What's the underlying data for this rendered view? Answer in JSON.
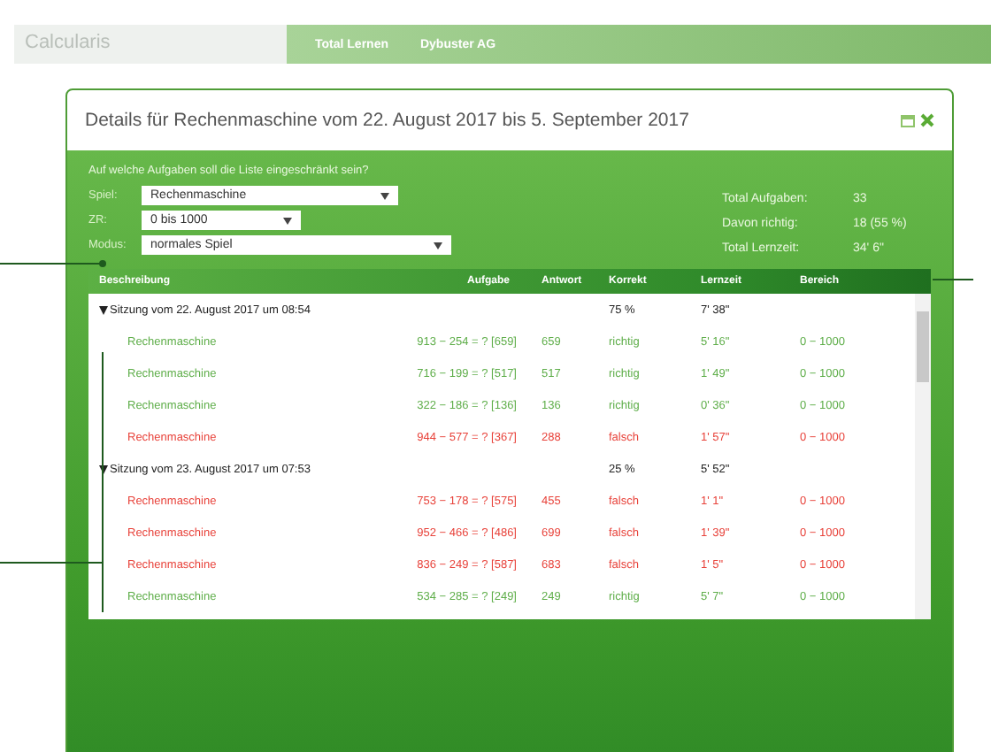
{
  "app": {
    "logo": "Calcularis",
    "nav": [
      "Total Lernen",
      "Dybuster AG"
    ]
  },
  "dialog": {
    "title": "Details für Rechenmaschine vom 22. August 2017 bis 5. September 2017",
    "question": "Auf welche Aufgaben soll die Liste eingeschränkt sein?",
    "filters": [
      {
        "label": "Spiel:",
        "value": "Rechenmaschine"
      },
      {
        "label": "ZR:",
        "value": "0 bis 1000"
      },
      {
        "label": "Modus:",
        "value": "normales Spiel"
      }
    ],
    "totals": [
      {
        "label": "Total Aufgaben:",
        "value": "33"
      },
      {
        "label": "Davon richtig:",
        "value": "18 (55 %)"
      },
      {
        "label": "Total Lernzeit:",
        "value": "34' 6\""
      }
    ],
    "columns": [
      "Beschreibung",
      "Aufgabe",
      "Antwort",
      "Korrekt",
      "Lernzeit",
      "Bereich"
    ],
    "sessions": [
      {
        "title": "Sitzung vom 22. August 2017 um 08:54",
        "expanded": true,
        "percent": "75 %",
        "time": "7' 38\"",
        "children": [
          {
            "name": "Rechenmaschine",
            "task": "913 − 254 = ? [659]",
            "answer": "659",
            "correct": true,
            "result": "richtig",
            "time": "5' 16\"",
            "range": "0 − 1000"
          },
          {
            "name": "Rechenmaschine",
            "task": "716 − 199 = ? [517]",
            "answer": "517",
            "correct": true,
            "result": "richtig",
            "time": "1' 49\"",
            "range": "0 − 1000"
          },
          {
            "name": "Rechenmaschine",
            "task": "322 − 186 = ? [136]",
            "answer": "136",
            "correct": true,
            "result": "richtig",
            "time": "0' 36\"",
            "range": "0 − 1000"
          },
          {
            "name": "Rechenmaschine",
            "task": "944 − 577 = ? [367]",
            "answer": "288",
            "correct": false,
            "result": "falsch",
            "time": "1' 57\"",
            "range": "0 − 1000"
          }
        ]
      },
      {
        "title": "Sitzung vom 23. August 2017 um 07:53",
        "expanded": true,
        "percent": "25 %",
        "time": "5' 52\"",
        "children": [
          {
            "name": "Rechenmaschine",
            "task": "753 − 178 = ? [575]",
            "answer": "455",
            "correct": false,
            "result": "falsch",
            "time": "1' 1\"",
            "range": "0 − 1000"
          },
          {
            "name": "Rechenmaschine",
            "task": "952 − 466 = ? [486]",
            "answer": "699",
            "correct": false,
            "result": "falsch",
            "time": "1' 39\"",
            "range": "0 − 1000"
          },
          {
            "name": "Rechenmaschine",
            "task": "836 − 249 = ? [587]",
            "answer": "683",
            "correct": false,
            "result": "falsch",
            "time": "1' 5\"",
            "range": "0 − 1000"
          },
          {
            "name": "Rechenmaschine",
            "task": "534 − 285 = ? [249]",
            "answer": "249",
            "correct": true,
            "result": "richtig",
            "time": "5' 7\"",
            "range": "0 − 1000"
          }
        ]
      }
    ]
  }
}
